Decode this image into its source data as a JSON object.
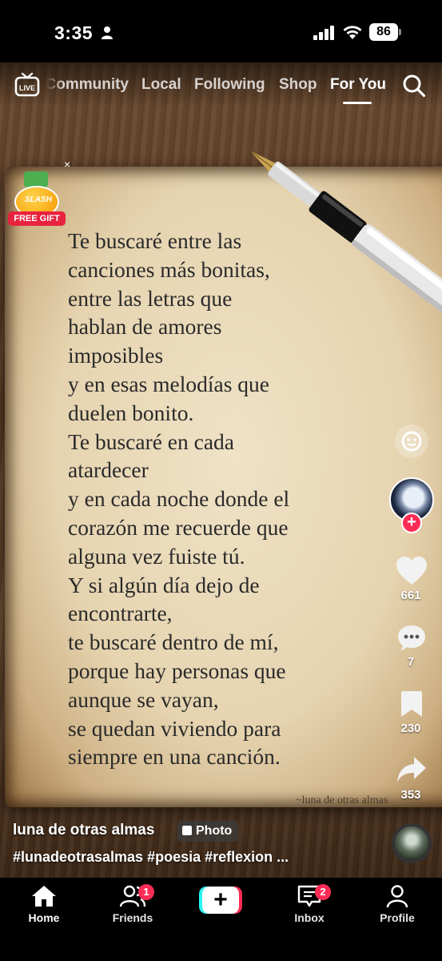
{
  "status_bar": {
    "time": "3:35",
    "battery": "86"
  },
  "top_nav": {
    "tabs": [
      {
        "label": "Community"
      },
      {
        "label": "Local"
      },
      {
        "label": "Following"
      },
      {
        "label": "Shop"
      },
      {
        "label": "For You"
      }
    ],
    "active_tab": "For You",
    "live_label": "LIVE"
  },
  "gift": {
    "badge_text": "SLASH",
    "label": "FREE GIFT",
    "close": "×"
  },
  "poem": {
    "lines": [
      "Te buscaré entre las",
      "canciones más bonitas,",
      "entre las letras que",
      "hablan de amores",
      "imposibles",
      "y en esas melodías que",
      "duelen bonito.",
      "Te buscaré en cada",
      "atardecer",
      "y en cada noche donde el",
      "corazón me recuerde que",
      "alguna vez fuiste tú.",
      "Y si algún día dejo de",
      "encontrarte,",
      "te buscaré dentro de mí,",
      "porque hay personas que",
      "aunque se vayan,",
      "se quedan viviendo para",
      "siempre en una canción."
    ],
    "signature": "~luna de otras almas"
  },
  "rail": {
    "likes": "661",
    "comments": "7",
    "saves": "230",
    "shares": "353",
    "follow": "+"
  },
  "caption": {
    "author": "luna de otras almas",
    "badge": "Photo",
    "hashtags": "#lunadeotrasalmas #poesia #reflexion ..."
  },
  "bottom_nav": {
    "home": "Home",
    "friends": "Friends",
    "friends_badge": "1",
    "create": "+",
    "inbox": "Inbox",
    "inbox_badge": "2",
    "profile": "Profile"
  },
  "colors": {
    "accent": "#fe2c55",
    "cyan": "#25f4ee",
    "paper": "#e6d4b0"
  }
}
